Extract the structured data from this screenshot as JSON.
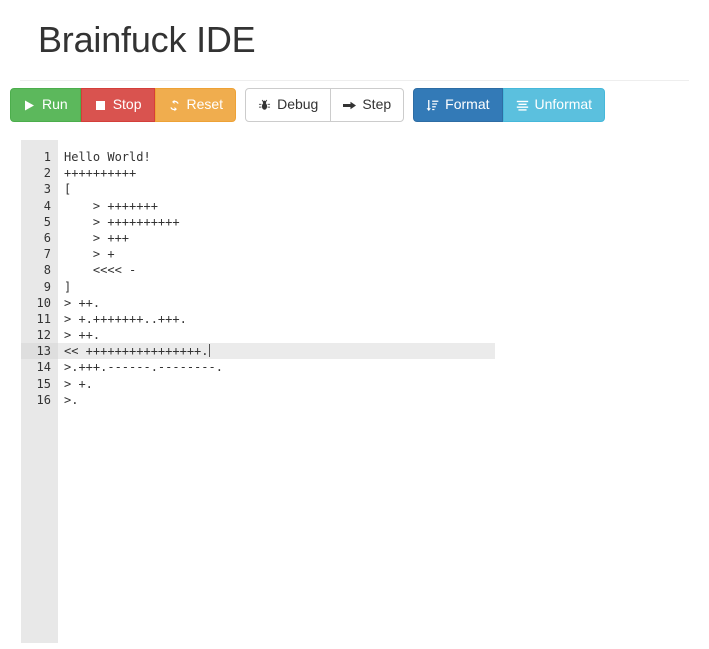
{
  "header": {
    "title": "Brainfuck IDE"
  },
  "toolbar": {
    "groups": [
      {
        "name": "execution-controls",
        "buttons": [
          {
            "label": "Run",
            "icon": "play-icon",
            "style": "btn-success"
          },
          {
            "label": "Stop",
            "icon": "stop-icon",
            "style": "btn-danger"
          },
          {
            "label": "Reset",
            "icon": "refresh-icon",
            "style": "btn-warning"
          }
        ]
      },
      {
        "name": "debug-controls",
        "buttons": [
          {
            "label": "Debug",
            "icon": "bug-icon",
            "style": "btn-default"
          },
          {
            "label": "Step",
            "icon": "arrow-right-icon",
            "style": "btn-default"
          }
        ]
      },
      {
        "name": "format-controls",
        "buttons": [
          {
            "label": "Format",
            "icon": "sort-amount-icon",
            "style": "btn-primary"
          },
          {
            "label": "Unformat",
            "icon": "align-justify-icon",
            "style": "btn-info"
          }
        ]
      }
    ]
  },
  "editor": {
    "active_line": 13,
    "lines": [
      {
        "num": "1",
        "text": "Hello World!"
      },
      {
        "num": "2",
        "text": "++++++++++"
      },
      {
        "num": "3",
        "text": "["
      },
      {
        "num": "4",
        "text": "    > +++++++"
      },
      {
        "num": "5",
        "text": "    > ++++++++++"
      },
      {
        "num": "6",
        "text": "    > +++"
      },
      {
        "num": "7",
        "text": "    > +"
      },
      {
        "num": "8",
        "text": "    <<<< -"
      },
      {
        "num": "9",
        "text": "]"
      },
      {
        "num": "10",
        "text": "> ++."
      },
      {
        "num": "11",
        "text": "> +.+++++++..+++."
      },
      {
        "num": "12",
        "text": "> ++."
      },
      {
        "num": "13",
        "text": "<< ++++++++++++++++."
      },
      {
        "num": "14",
        "text": ">.+++.------.--------."
      },
      {
        "num": "15",
        "text": "> +."
      },
      {
        "num": "16",
        "text": ">."
      }
    ]
  },
  "colors": {
    "run": "#5cb85c",
    "stop": "#d9534f",
    "reset": "#f0ad4e",
    "format": "#337ab7",
    "unformat": "#5bc0de",
    "gutter": "#e8e8e8",
    "active_line": "#ebebeb"
  }
}
